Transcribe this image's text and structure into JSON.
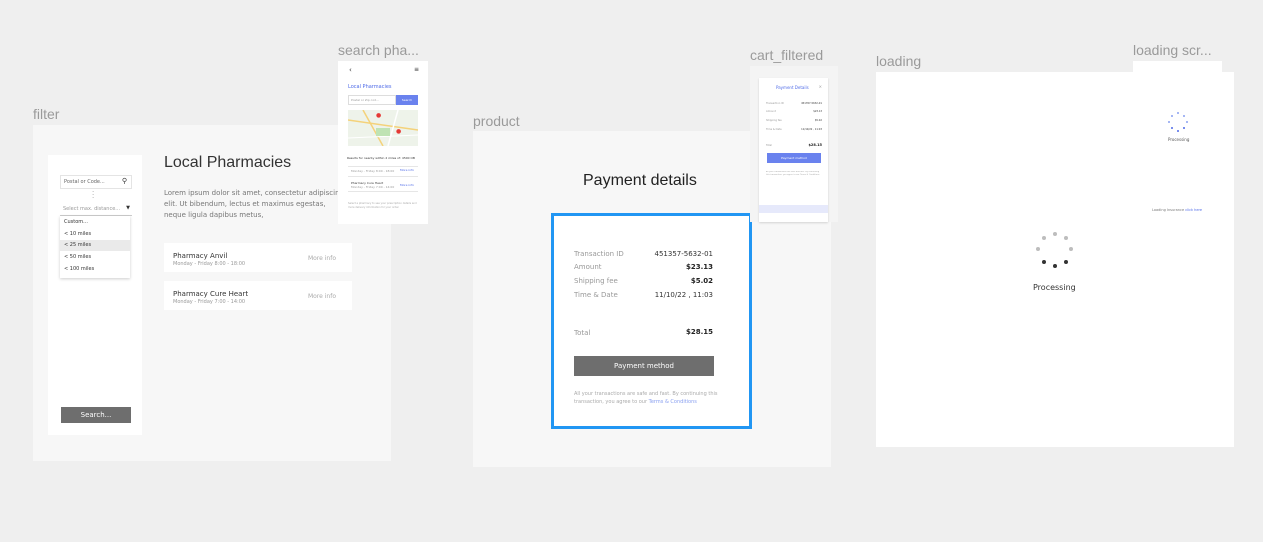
{
  "frames": {
    "filter": "filter",
    "search": "search pha...",
    "product": "product",
    "cart": "cart_filtered",
    "loading": "loading",
    "loading_screen": "loading scr..."
  },
  "filter": {
    "postal_placeholder": "Postal or Code...",
    "distance_placeholder": "Select max. distance...",
    "custom_label": "Custom...",
    "options": [
      "< 10 miles",
      "< 25 miles",
      "< 50 miles",
      "< 100 miles"
    ],
    "search_button": "Search...",
    "title": "Local Pharmacies",
    "body_text": "Lorem ipsum dolor sit amet, consectetur adipiscing elit. Ut bibendum, lectus et maximus egestas, neque ligula dapibus metus,",
    "pharmacies": [
      {
        "name": "Pharmacy Anvil",
        "hours": "Monday - Friday 8:00 - 18:00",
        "link": "More info"
      },
      {
        "name": "Pharmacy Cure Heart",
        "hours": "Monday - Friday 7:00 - 14:00",
        "link": "More info"
      }
    ]
  },
  "search": {
    "title": "Local Pharmacies",
    "input_placeholder": "Postal or Zip cod...",
    "button": "Search",
    "results_text": "Results for nearby within 2 miles of: 4500 OB",
    "items": [
      {
        "name": "Monday - Friday 8:00 - 18:00",
        "link": "More info"
      },
      {
        "name": "Pharmacy Cure Heart",
        "hours": "Monday - Friday 7:00 - 14:00",
        "link": "More info"
      }
    ],
    "footnote": "Select a pharmacy to see your prescription details and more delivery information for your order."
  },
  "product": {
    "title": "Payment details",
    "rows": [
      {
        "label": "Transaction ID",
        "value": "451357-5632-01"
      },
      {
        "label": "Amount",
        "value": "$23.13"
      },
      {
        "label": "Shipping fee",
        "value": "$5.02"
      },
      {
        "label": "Time & Date",
        "value": "11/10/22 , 11:03"
      }
    ],
    "total_label": "Total",
    "total_value": "$28.15",
    "button": "Payment method",
    "note": "All your transactions are safe and fast. By continuing this transaction, you agree to our",
    "terms_link": "Terms & Conditions"
  },
  "cart": {
    "title": "Payment Details",
    "rows": [
      {
        "label": "Transaction ID",
        "value": "451357-5632-01"
      },
      {
        "label": "Amount",
        "value": "$23.13"
      },
      {
        "label": "Shipping fee",
        "value": "$5.02"
      },
      {
        "label": "Time & Date",
        "value": "11/10/22 , 11:03"
      }
    ],
    "total_label": "Total",
    "total_value": "$28.15",
    "button": "Payment method",
    "note": "All your transactions are safe and fast. By continuing this transaction, you agree to our Terms & Conditions"
  },
  "loading": {
    "processing": "Processing",
    "small_processing": "Processing",
    "loading_text": "Loading Insurance",
    "loading_link": "click here"
  },
  "colors": {
    "accent_blue": "#4f6be8",
    "selection_blue": "#2196f3",
    "grey_button": "#6e6e6e"
  }
}
